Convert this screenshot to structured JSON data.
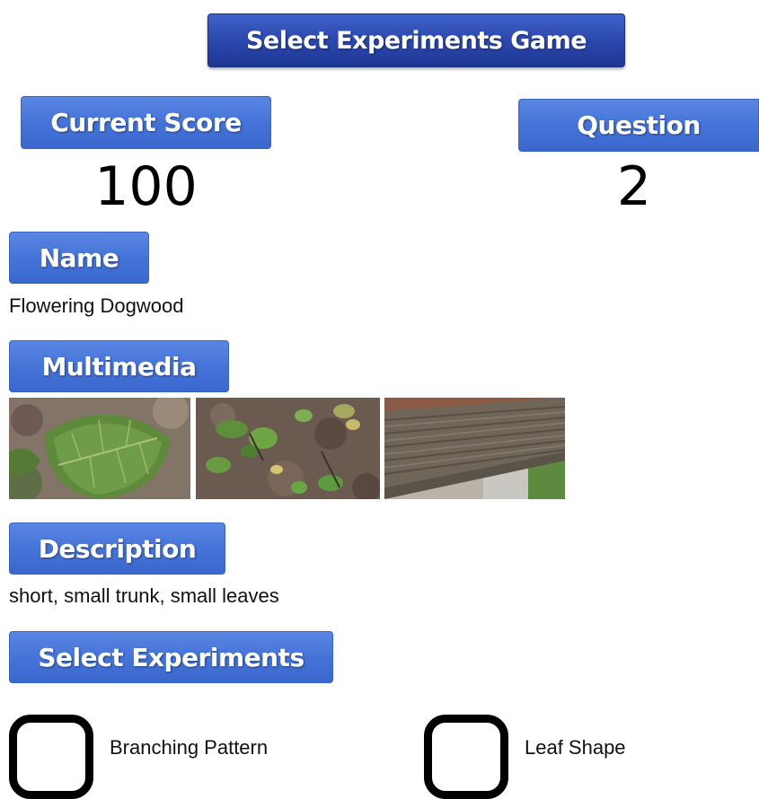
{
  "header": {
    "title": "Select Experiments Game"
  },
  "score": {
    "label": "Current Score",
    "value": "100"
  },
  "question": {
    "label": "Question",
    "value": "2"
  },
  "name": {
    "label": "Name",
    "value": "Flowering Dogwood"
  },
  "multimedia": {
    "label": "Multimedia",
    "images": [
      {
        "subject": "leaf-closeup"
      },
      {
        "subject": "ground-plants"
      },
      {
        "subject": "bark-closeup"
      }
    ]
  },
  "description": {
    "label": "Description",
    "value": "short, small trunk, small leaves"
  },
  "experiments": {
    "label": "Select Experiments",
    "options": [
      {
        "label": "Branching Pattern",
        "checked": false
      },
      {
        "label": "Leaf Shape",
        "checked": false
      }
    ]
  },
  "colors": {
    "header_button": "#2b48ad",
    "section_button": "#4574d8"
  }
}
